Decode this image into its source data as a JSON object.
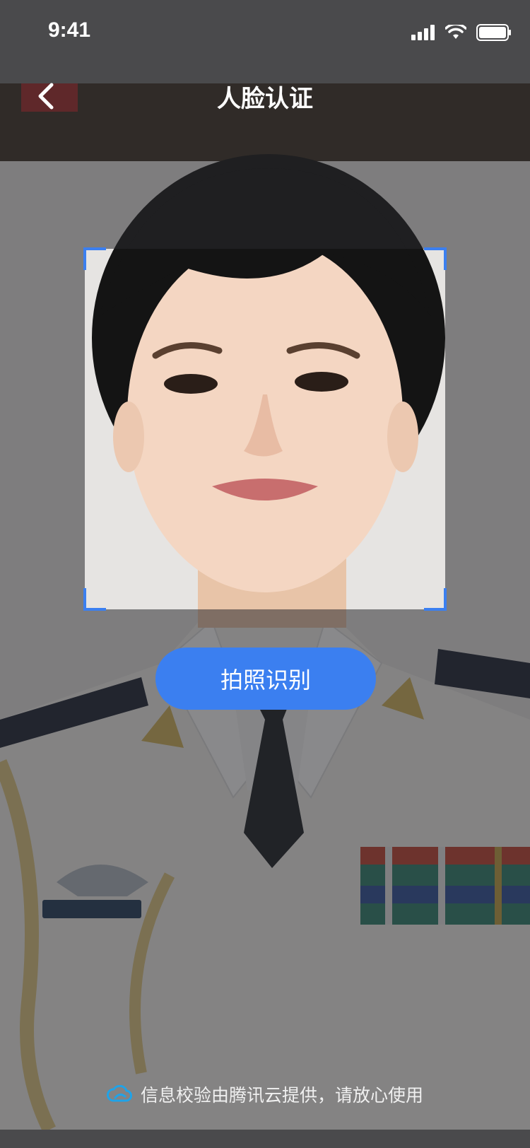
{
  "status_bar": {
    "time": "9:41",
    "icons": [
      "signal-icon",
      "wifi-icon",
      "battery-icon"
    ]
  },
  "nav": {
    "back_icon": "chevron-left-icon",
    "title": "人脸认证"
  },
  "camera": {
    "frame_corner_color": "#3b7ff0",
    "overlay_color": "#2828306e"
  },
  "actions": {
    "capture_label": "拍照识别"
  },
  "footer": {
    "icon": "tencent-cloud-icon",
    "text": "信息校验由腾讯云提供，请放心使用"
  },
  "colors": {
    "accent": "#3b7ff0",
    "background": "#4a4a4c"
  }
}
